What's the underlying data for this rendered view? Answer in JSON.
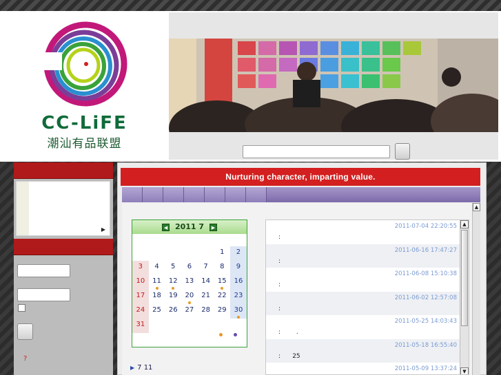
{
  "header": {
    "logo_en": "CC-LiFE",
    "logo_cn": "潮汕有品联盟"
  },
  "main": {
    "title": "Nurturing character, imparting value."
  },
  "calendar": {
    "year": "2011",
    "month": "7",
    "rows": [
      [
        "",
        "",
        "",
        "",
        "",
        "1",
        "2"
      ],
      [
        "3",
        "4",
        "5",
        "6",
        "7",
        "8",
        "9"
      ],
      [
        "10",
        "11",
        "12",
        "13",
        "14",
        "15",
        "16"
      ],
      [
        "17",
        "18",
        "19",
        "20",
        "21",
        "22",
        "23"
      ],
      [
        "24",
        "25",
        "26",
        "27",
        "28",
        "29",
        "30"
      ],
      [
        "31",
        "",
        "",
        "",
        "",
        "",
        ""
      ]
    ],
    "event_days": [
      "11",
      "12",
      "15",
      "20",
      "30"
    ],
    "legend_colors": [
      "#e69a28",
      "#6a4ab0"
    ]
  },
  "bottom_link": "7 11",
  "sidebar": {
    "question_mark": "?"
  },
  "posts": [
    {
      "date": "2011-07-04 22:20:55",
      "text": ":"
    },
    {
      "date": "2011-06-16 17:47:27",
      "text": ":"
    },
    {
      "date": "2011-06-08 15:10:38",
      "text": ":"
    },
    {
      "date": "2011-06-02 12:57:08",
      "text": ":"
    },
    {
      "date": "2011-05-25 14:03:43",
      "text": ":        ."
    },
    {
      "date": "2011-05-18 16:55:40",
      "text": ":      25"
    },
    {
      "date": "2011-05-09 13:37:24",
      "text": ""
    }
  ],
  "colors": {
    "brand_red": "#d31f1f",
    "tab_purple": "#8a78b0",
    "calendar_green": "#3aa23a"
  }
}
